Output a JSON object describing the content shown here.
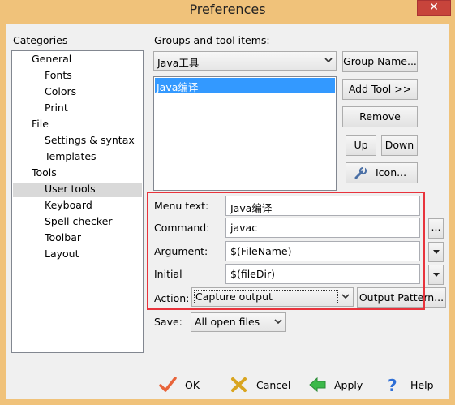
{
  "window": {
    "title": "Preferences",
    "close_glyph": "✕"
  },
  "categories": {
    "label": "Categories",
    "items": [
      {
        "label": "General",
        "level": 0
      },
      {
        "label": "Fonts",
        "level": 1
      },
      {
        "label": "Colors",
        "level": 1
      },
      {
        "label": "Print",
        "level": 1
      },
      {
        "label": "File",
        "level": 0
      },
      {
        "label": "Settings & syntax",
        "level": 1
      },
      {
        "label": "Templates",
        "level": 1
      },
      {
        "label": "Tools",
        "level": 0
      },
      {
        "label": "User tools",
        "level": 1,
        "selected": true
      },
      {
        "label": "Keyboard",
        "level": 1
      },
      {
        "label": "Spell checker",
        "level": 1
      },
      {
        "label": "Toolbar",
        "level": 1
      },
      {
        "label": "Layout",
        "level": 1
      }
    ]
  },
  "groups": {
    "label": "Groups and tool items:",
    "selected_group": "Java工具",
    "tool_items": [
      {
        "label": "Java编译",
        "selected": true
      }
    ]
  },
  "buttons": {
    "group_name": "Group Name...",
    "add_tool": "Add Tool >>",
    "remove": "Remove",
    "up": "Up",
    "down": "Down",
    "icon": "Icon...",
    "browse": "...",
    "output_pattern": "Output Pattern..."
  },
  "tool_form": {
    "menu_text_label": "Menu text:",
    "menu_text_value": "Java编译",
    "command_label": "Command:",
    "command_value": "javac",
    "argument_label": "Argument:",
    "argument_value": "$(FileName)",
    "initial_label": "Initial",
    "initial_value": "$(fileDir)",
    "action_label": "Action:",
    "action_value": "Capture output",
    "save_label": "Save:",
    "save_value": "All open files"
  },
  "dialog_buttons": {
    "ok": "OK",
    "cancel": "Cancel",
    "apply": "Apply",
    "help": "Help"
  },
  "colors": {
    "title_frame": "#f0c27a",
    "selection": "#3399ff",
    "highlight_box": "#e8333c",
    "close_button": "#c7443b"
  }
}
